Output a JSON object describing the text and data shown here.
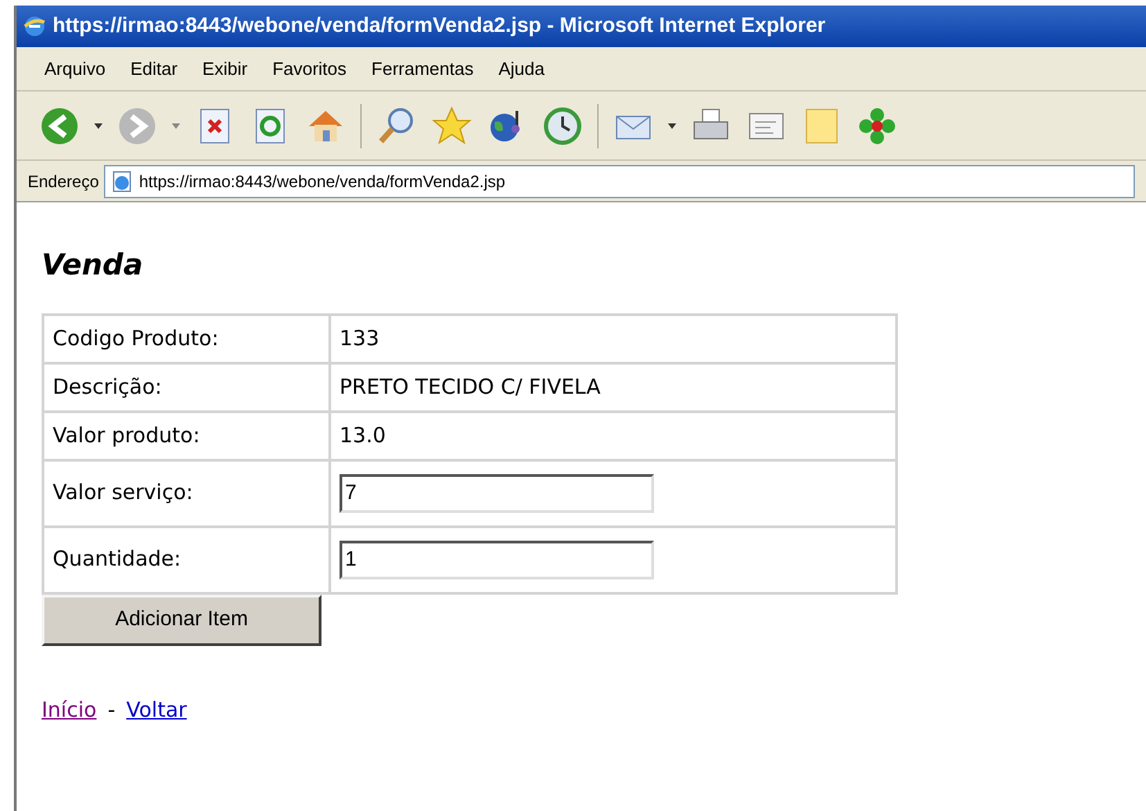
{
  "window": {
    "title": "https://irmao:8443/webone/venda/formVenda2.jsp - Microsoft Internet Explorer"
  },
  "menu": [
    "Arquivo",
    "Editar",
    "Exibir",
    "Favoritos",
    "Ferramentas",
    "Ajuda"
  ],
  "address_bar": {
    "label": "Endereço",
    "value": "https://irmao:8443/webone/venda/formVenda2.jsp"
  },
  "page": {
    "heading": "Venda",
    "rows": [
      {
        "kind": "text",
        "label": "Codigo Produto:",
        "value": "133"
      },
      {
        "kind": "text",
        "label": "Descrição:",
        "value": "PRETO TECIDO C/ FIVELA"
      },
      {
        "kind": "text",
        "label": "Valor produto:",
        "value": "13.0"
      },
      {
        "kind": "input",
        "label": "Valor serviço:",
        "value": "7"
      },
      {
        "kind": "input",
        "label": "Quantidade:",
        "value": "1"
      }
    ],
    "button": "Adicionar Item",
    "links": [
      {
        "label": "Início",
        "visited": true
      },
      {
        "label": "Voltar",
        "visited": false
      }
    ],
    "link_separator": "-"
  }
}
